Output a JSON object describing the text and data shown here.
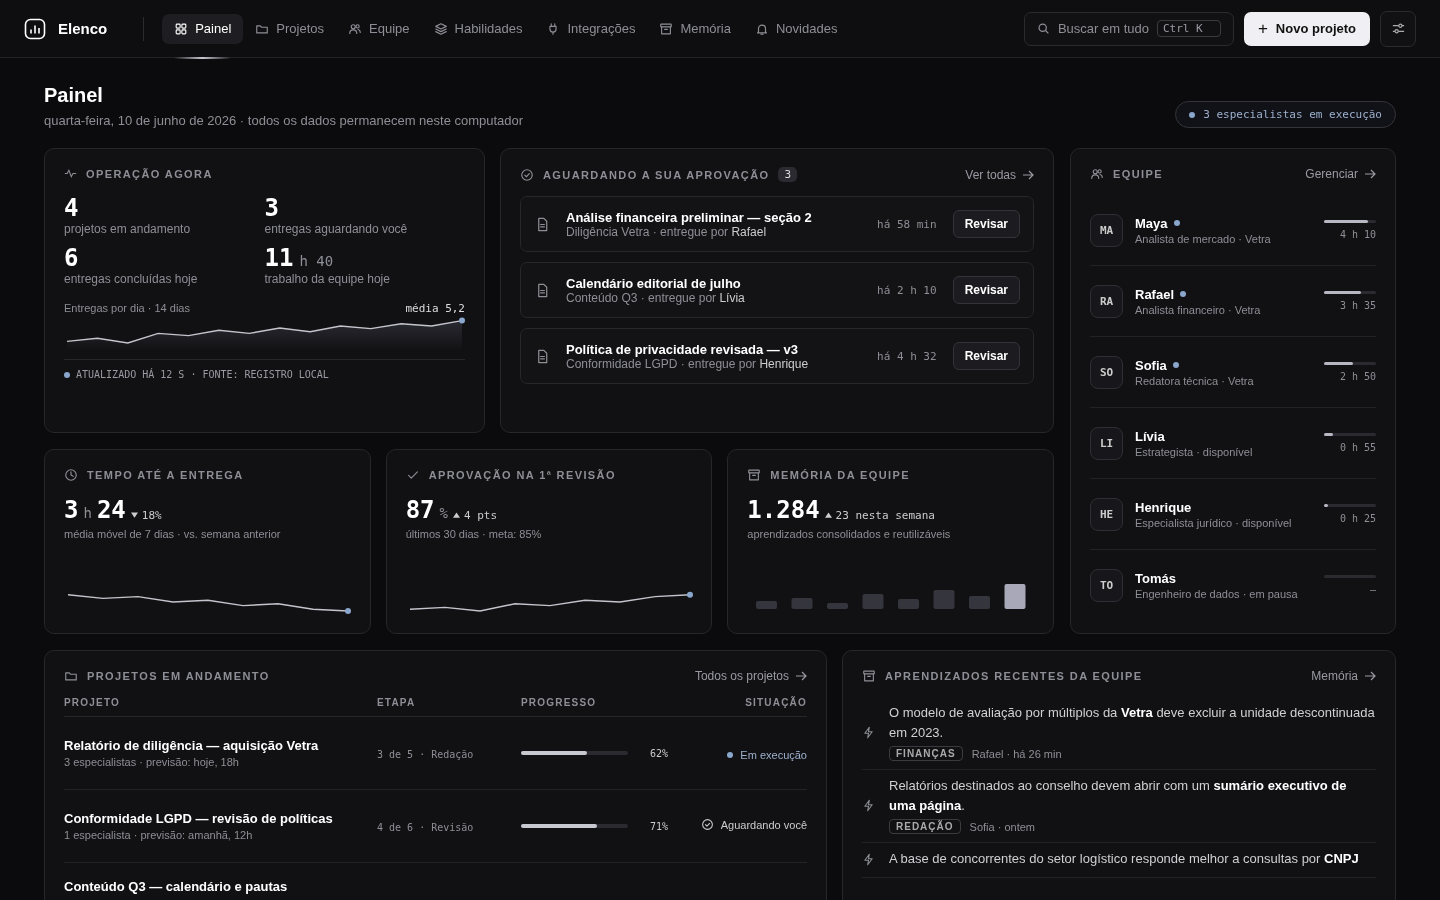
{
  "brand": {
    "name": "Elenco"
  },
  "nav": [
    {
      "label": "Painel",
      "selected": true
    },
    {
      "label": "Projetos",
      "selected": false
    },
    {
      "label": "Equipe",
      "selected": false
    },
    {
      "label": "Habilidades",
      "selected": false
    },
    {
      "label": "Integrações",
      "selected": false
    },
    {
      "label": "Memória",
      "selected": false
    },
    {
      "label": "Novidades",
      "selected": false
    }
  ],
  "search": {
    "placeholder": "Buscar em tudo",
    "shortcut": "Ctrl K"
  },
  "new_button": {
    "icon": "+",
    "label": "Novo projeto"
  },
  "page": {
    "title": "Painel",
    "subtitle": "quarta-feira, 10 de junho de 2026 · todos os dados permanecem neste computador",
    "status_pill": "3 especialistas em execução"
  },
  "operation": {
    "title": "OPERAÇÃO AGORA",
    "stats": [
      {
        "value": "4",
        "label": "projetos em andamento"
      },
      {
        "value": "3",
        "label": "entregas aguardando você"
      },
      {
        "value": "6",
        "label": "entregas concluídas hoje"
      },
      {
        "value": "11",
        "unit": "h 40",
        "label": "trabalho da equipe hoje"
      }
    ],
    "chart_label": "Entregas por dia · 14 dias",
    "chart_note": "média 5,2",
    "footer": "ATUALIZADO HÁ 12 S · FONTE: REGISTRO LOCAL"
  },
  "approvals": {
    "title": "AGUARDANDO A SUA APROVAÇÃO",
    "count": "3",
    "link": "Ver todas",
    "items": [
      {
        "title": "Análise financeira preliminar — seção 2",
        "project": "Diligência Vetra · entregue por ",
        "author": "Rafael",
        "time": "há 58 min",
        "action": "Revisar"
      },
      {
        "title": "Calendário editorial de julho",
        "project": "Conteúdo Q3 · entregue por ",
        "author": "Lívia",
        "time": "há 2 h 10",
        "action": "Revisar"
      },
      {
        "title": "Política de privacidade revisada — v3",
        "project": "Conformidade LGPD · entregue por ",
        "author": "Henrique",
        "time": "há 4 h 32",
        "action": "Revisar"
      }
    ]
  },
  "team": {
    "title": "EQUIPE",
    "link": "Gerenciar",
    "members": [
      {
        "initials": "MA",
        "name": "Maya",
        "role": "Analista de mercado · Vetra",
        "active": true,
        "level": 0.85,
        "reading": "4 h 10"
      },
      {
        "initials": "RA",
        "name": "Rafael",
        "role": "Analista financeiro · Vetra",
        "active": true,
        "level": 0.71,
        "reading": "3 h 35"
      },
      {
        "initials": "SO",
        "name": "Sofia",
        "role": "Redatora técnica · Vetra",
        "active": true,
        "level": 0.56,
        "reading": "2 h 50"
      },
      {
        "initials": "LI",
        "name": "Lívia",
        "role": "Estrategista · disponível",
        "active": false,
        "level": 0.17,
        "reading": "0 h 55"
      },
      {
        "initials": "HE",
        "name": "Henrique",
        "role": "Especialista jurídico · disponível",
        "active": false,
        "level": 0.07,
        "reading": "0 h 25"
      },
      {
        "initials": "TO",
        "name": "Tomás",
        "role": "Engenheiro de dados · em pausa",
        "active": false,
        "level": 0,
        "reading": "–"
      }
    ]
  },
  "metrics": [
    {
      "title": "TEMPO ATÉ A ENTREGA",
      "value": "3",
      "unit": "h",
      "value2": "24",
      "kind": "down",
      "delta": "18%",
      "caption": "média móvel de 7 dias · vs. semana anterior"
    },
    {
      "title": "APROVAÇÃO NA 1ª REVISÃO",
      "value": "87",
      "unit": "%",
      "kind": "up",
      "delta": "4 pts",
      "caption": "últimos 30 dias · meta: 85%"
    },
    {
      "title": "MEMÓRIA DA EQUIPE",
      "value": "1.284",
      "kind": "up",
      "delta": "23 nesta semana",
      "caption": "aprendizados consolidados e reutilizáveis"
    }
  ],
  "projects": {
    "title": "PROJETOS EM ANDAMENTO",
    "link": "Todos os projetos",
    "columns": [
      "PROJETO",
      "ETAPA",
      "PROGRESSO",
      "SITUAÇÃO"
    ],
    "rows": [
      {
        "name": "Relatório de diligência — aquisição Vetra",
        "meta": "3 especialistas · previsão: hoje, 18h",
        "stage": "3 de 5 · Redação",
        "level": 0.62,
        "percent": "62%",
        "status": "Em execução",
        "kind": "running"
      },
      {
        "name": "Conformidade LGPD — revisão de políticas",
        "meta": "1 especialista · previsão: amanhã, 12h",
        "stage": "4 de 6 · Revisão",
        "level": 0.71,
        "percent": "71%",
        "status": "Aguardando você",
        "kind": "waiting"
      },
      {
        "name": "Conteúdo Q3 — calendário e pautas"
      }
    ]
  },
  "learnings": {
    "title": "APRENDIZADOS RECENTES DA EQUIPE",
    "link": "Memória",
    "items": [
      {
        "text": "O modelo de avaliação por múltiplos da **Vetra** deve excluir a unidade descontinuada em 2023.",
        "tag": "FINANÇAS",
        "meta": "Rafael · há 26 min"
      },
      {
        "text": "Relatórios destinados ao conselho devem abrir com um **sumário executivo de uma página**.",
        "tag": "REDAÇÃO",
        "meta": "Sofia · ontem"
      },
      {
        "text": "A base de concorrentes do setor logístico responde melhor a consultas por **CNPJ**"
      }
    ]
  }
}
